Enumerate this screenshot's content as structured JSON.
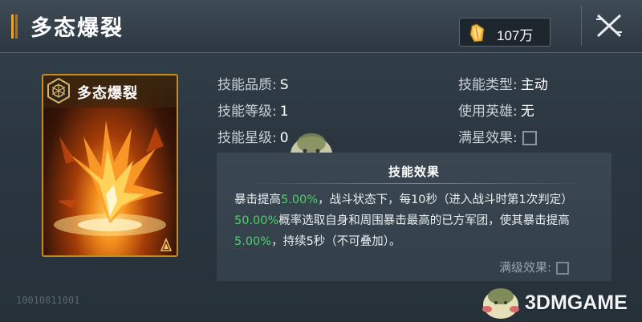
{
  "header": {
    "title": "多态爆裂",
    "currency_value": "107万",
    "currency_icon": "gold-crystal-icon",
    "close_icon": "close-icon"
  },
  "card": {
    "name": "多态爆裂",
    "code": "10010811001",
    "emblem_icon": "hexagon-emblem-icon",
    "corner_icon": "skill-corner-icon"
  },
  "attributes": {
    "quality_label": "技能品质:",
    "quality_value": "S",
    "level_label": "技能等级:",
    "level_value": "1",
    "star_label": "技能星级:",
    "star_value": "0",
    "type_label": "技能类型:",
    "type_value": "主动",
    "hero_label": "使用英雄:",
    "hero_value": "无",
    "fullstar_label": "满星效果:"
  },
  "effect": {
    "title": "技能效果",
    "desc_parts": [
      "暴击提高",
      "5.00%",
      "，战斗状态下，每10秒（进入战斗时第1次判定）",
      "50.00%",
      "概率选取自身和周围暴击最高的已方军团，使其暴击提高",
      "5.00%",
      "，持续5秒（不可叠加）。"
    ],
    "full_level_label": "满级效果:"
  },
  "watermark": {
    "text": "3DMGAME"
  },
  "colors": {
    "accent": "#e9a531",
    "highlight": "#4fd06a",
    "panel": "#2b3640"
  }
}
